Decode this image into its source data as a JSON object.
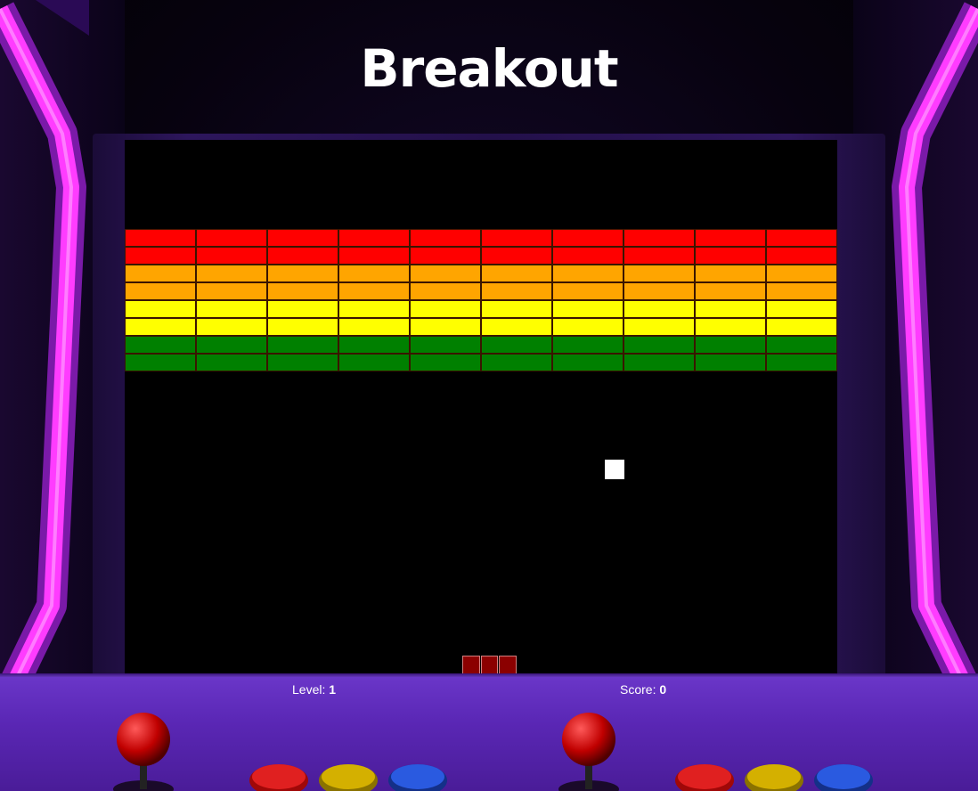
{
  "game": {
    "title": "Breakout",
    "level_label": "Level:",
    "level_value": "1",
    "score_label": "Score:",
    "score_value": "0"
  },
  "bricks": {
    "rows": 8,
    "cols": 10,
    "row_colors": [
      "#ff0000",
      "#ff0000",
      "#ffa500",
      "#ffa500",
      "#ffff00",
      "#ffff00",
      "#008000",
      "#008000"
    ]
  },
  "paddle": {
    "segments": 3,
    "color": "#8b0000"
  },
  "ball": {
    "color": "#ffffff"
  },
  "cabinet": {
    "neon_color": "#e030ff",
    "deck_color": "#5a27b5",
    "joystick_color": "#c00000",
    "button_colors": [
      "#d01010",
      "#d4b000",
      "#2050d0"
    ]
  }
}
